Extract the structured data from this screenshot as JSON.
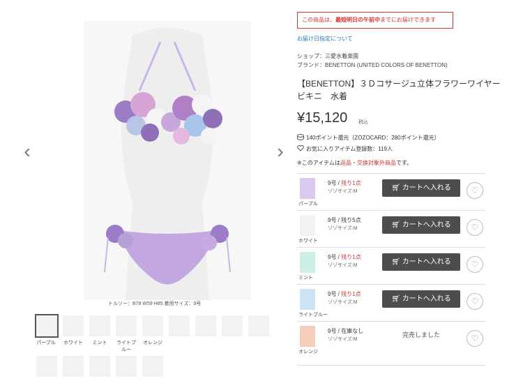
{
  "gallery": {
    "caption": "トルソー：B78 W59 H85 着用サイズ：9号",
    "thumbs": [
      {
        "label": "パープル",
        "color": "#b9a1d6"
      },
      {
        "label": "ホワイト",
        "color": "#f5f5f5"
      },
      {
        "label": "ミント",
        "color": "#a5e0d3"
      },
      {
        "label": "ライトブ\nルー",
        "color": "#a7d1ef"
      },
      {
        "label": "オレンジ",
        "color": "#f4b79a"
      }
    ]
  },
  "notice": {
    "prefix": "この商品は、",
    "emphasis": "最短明日の午前中",
    "suffix": "までにお届けできます"
  },
  "delivery_link": "お届け日指定について",
  "shop": "ショップ：三愛水着楽園",
  "brand": "ブランド：BENETTON (UNITED COLORS OF BENETTON)",
  "title": "【BENETTON】３Ｄコサージュ立体フラワーワイヤービキニ　水着",
  "price": "¥15,120",
  "tax_label": "税込",
  "points": "140ポイント還元（ZOZOCARD：280ポイント還元）",
  "fav_count": "お気に入りアイテム登録数：119人",
  "return_note_prefix": "※このアイテムは",
  "return_note_red": "返品・交換対象外商品",
  "return_note_suffix": "です。",
  "variants": [
    {
      "color": "パープル",
      "size": "9号 / ",
      "stock": "残り1点",
      "sub": "ゾゾサイズ:M",
      "button": "カートへ入れる",
      "swatch": "#b9a1d6"
    },
    {
      "color": "ホワイト",
      "size": "9号 / ",
      "stock": "残り5点",
      "sub": "ゾゾサイズ:M",
      "button": "カートへ入れる",
      "swatch": "#efefef"
    },
    {
      "color": "ミント",
      "size": "9号 / ",
      "stock": "残り1点",
      "sub": "ゾゾサイズ:M",
      "button": "カートへ入れる",
      "swatch": "#a5e0d3"
    },
    {
      "color": "ライトブルー",
      "size": "9号 / ",
      "stock": "残り1点",
      "sub": "ゾゾサイズ:M",
      "button": "カートへ入れる",
      "swatch": "#a7d1ef"
    },
    {
      "color": "オレンジ",
      "size": "9号 / ",
      "stock": "在庫なし",
      "sub": "ゾゾサイズ:M",
      "button": "完売しました",
      "swatch": "#f4b79a"
    }
  ]
}
